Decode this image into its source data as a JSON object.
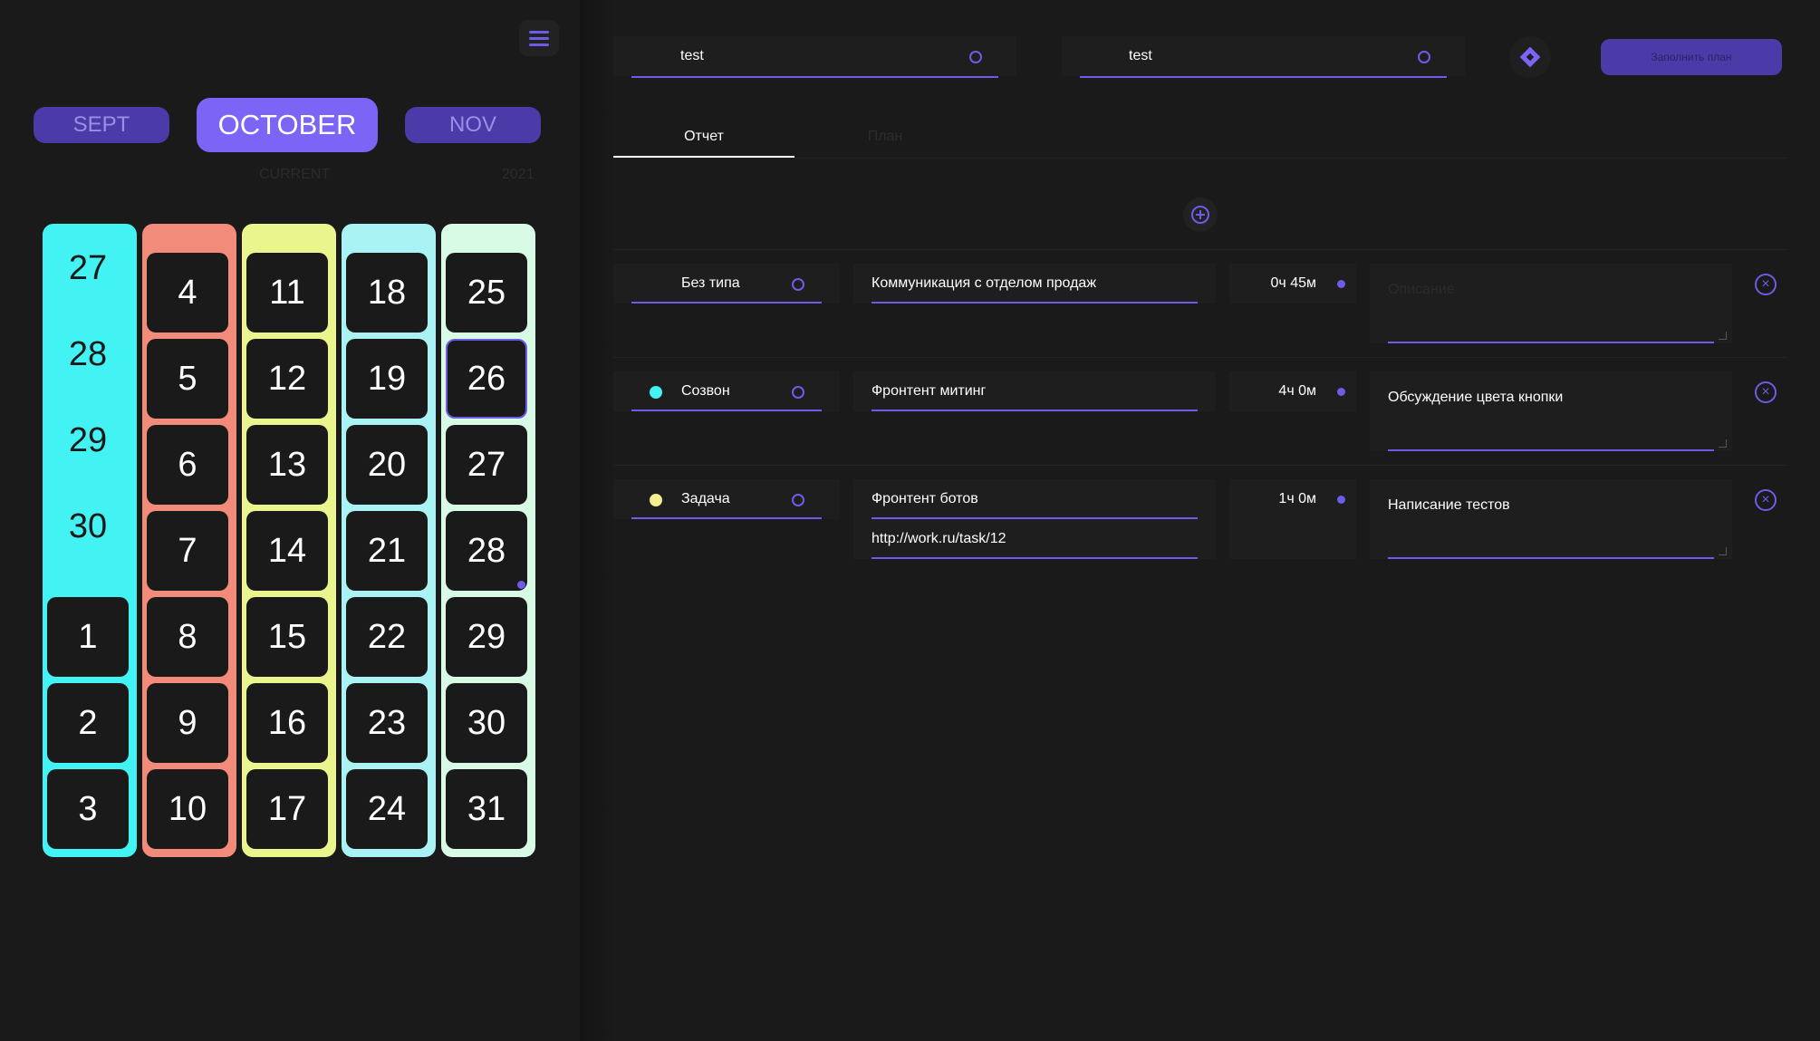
{
  "calendar": {
    "months": {
      "prev": "SEPT",
      "current": "OCTOBER",
      "next": "NOV"
    },
    "captions": {
      "current": "CURRENT",
      "year": "2021"
    },
    "columns": [
      {
        "color": "#43f2f2",
        "days": [
          "27",
          "28",
          "29",
          "30",
          "1",
          "2",
          "3"
        ],
        "prev_month_count": 4
      },
      {
        "color": "#f28b79",
        "days": [
          "4",
          "5",
          "6",
          "7",
          "8",
          "9",
          "10"
        ]
      },
      {
        "color": "#eaf58e",
        "days": [
          "11",
          "12",
          "13",
          "14",
          "15",
          "16",
          "17"
        ]
      },
      {
        "color": "#a9f3f5",
        "days": [
          "18",
          "19",
          "20",
          "21",
          "22",
          "23",
          "24"
        ]
      },
      {
        "color": "#d7fbe5",
        "days": [
          "25",
          "26",
          "27",
          "28",
          "29",
          "30",
          "31"
        ],
        "selected": "26",
        "marked": "28"
      }
    ]
  },
  "header": {
    "input1": "test",
    "input2": "test",
    "fill_plan_button": "Заполнить план"
  },
  "tabs": {
    "report": "Отчет",
    "plan": "План"
  },
  "entries": [
    {
      "type": "Без типа",
      "type_color": "",
      "task": "Коммуникация с отделом продаж",
      "link": "",
      "time": "0ч 45м",
      "description": "",
      "description_placeholder": "Описание"
    },
    {
      "type": "Созвон",
      "type_color": "#43f2f2",
      "task": "Фронтент митинг",
      "link": "",
      "time": "4ч 0м",
      "description": "Обсуждение цвета кнопки",
      "description_placeholder": ""
    },
    {
      "type": "Задача",
      "type_color": "#f5ee8e",
      "task": "Фронтент ботов",
      "link": "http://work.ru/task/12",
      "time": "1ч 0м",
      "description": "Написание тестов",
      "description_placeholder": ""
    }
  ],
  "colors": {
    "accent": "#6c5ce7",
    "accent_button": "#7c64f7",
    "background": "#1b1a1a"
  }
}
